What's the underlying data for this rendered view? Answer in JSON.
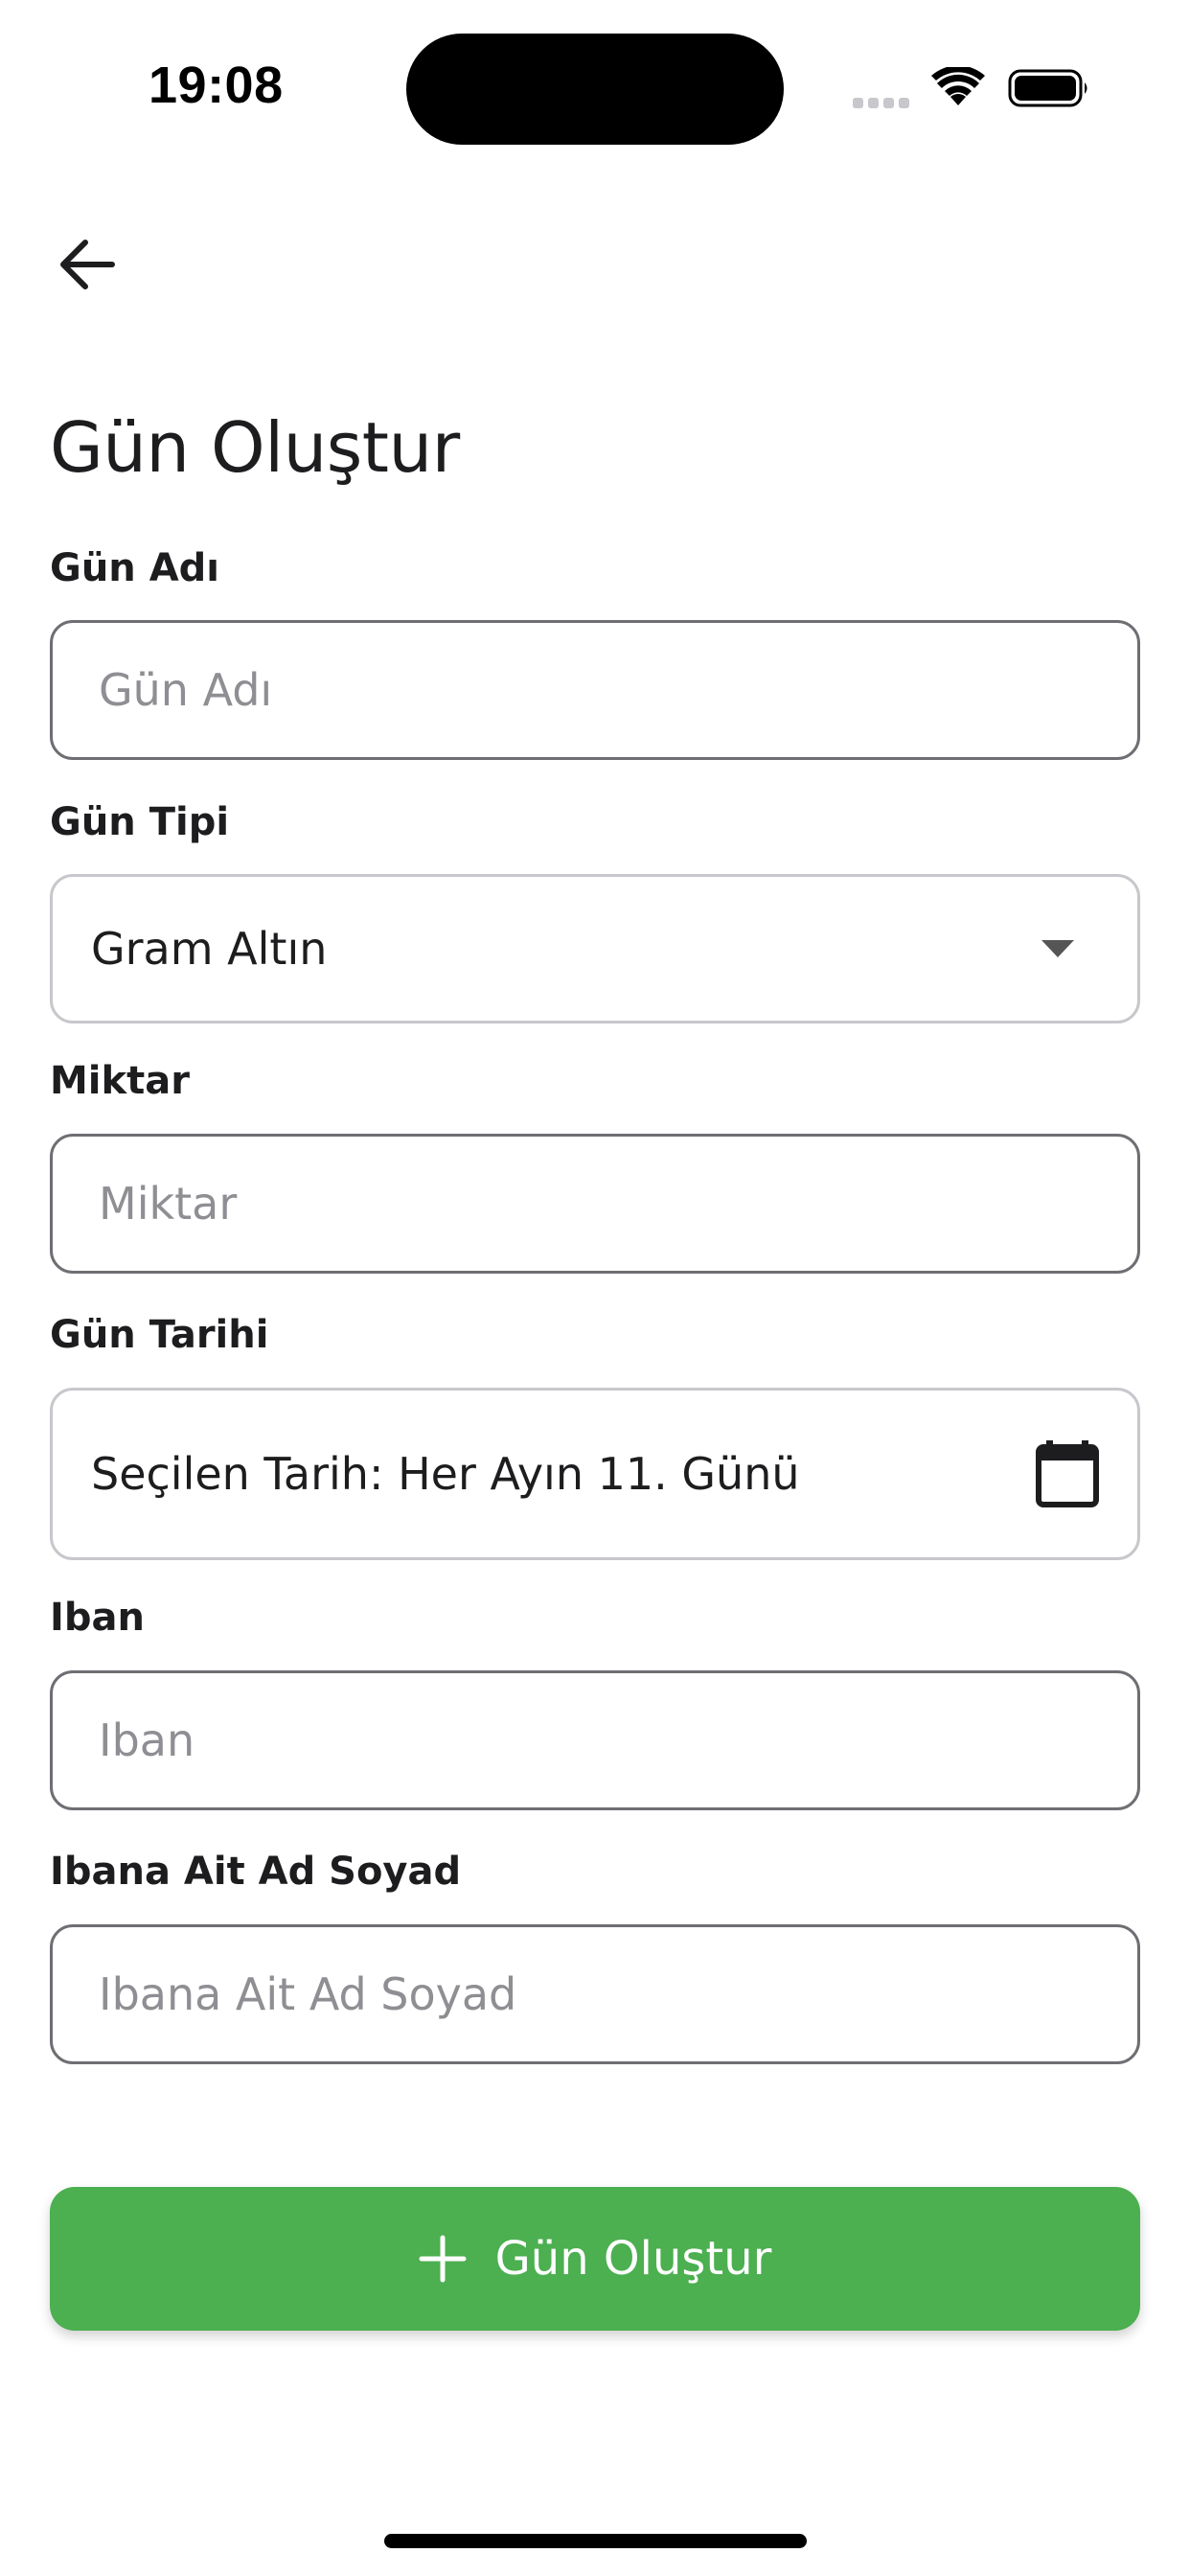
{
  "status_bar": {
    "time": "19:08"
  },
  "header": {
    "back_icon": "arrow-left-icon",
    "title": "Gün Oluştur"
  },
  "form": {
    "name": {
      "label": "Gün Adı",
      "placeholder": "Gün Adı",
      "value": ""
    },
    "type": {
      "label": "Gün Tipi",
      "value": "Gram Altın",
      "icon": "chevron-down-icon"
    },
    "amount": {
      "label": "Miktar",
      "placeholder": "Miktar",
      "value": ""
    },
    "date": {
      "label": "Gün Tarihi",
      "value": "Seçilen Tarih: Her Ayın 11. Günü",
      "icon": "calendar-icon"
    },
    "iban": {
      "label": "Iban",
      "placeholder": "Iban",
      "value": ""
    },
    "iban_owner": {
      "label": "Ibana Ait Ad Soyad",
      "placeholder": "Ibana Ait Ad Soyad",
      "value": ""
    }
  },
  "submit": {
    "icon": "plus-icon",
    "label": "Gün Oluştur",
    "color": "#4caf50"
  }
}
